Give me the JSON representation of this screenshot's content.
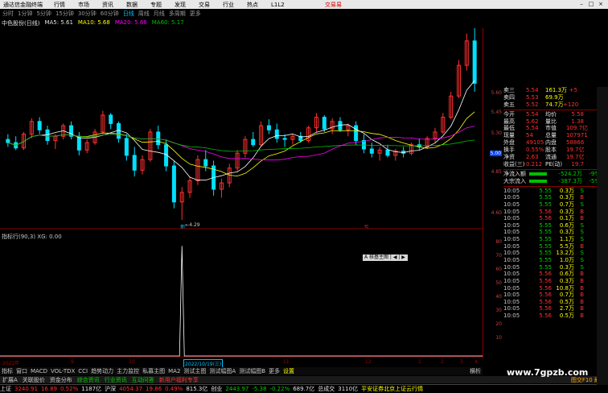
{
  "app": {
    "title": "通达信金融终端",
    "menus": [
      "行情",
      "市场",
      "资讯",
      "数据",
      "专题",
      "发现",
      "交易",
      "行业",
      "热点",
      "L1L2"
    ],
    "trade": "交易易"
  },
  "periods": [
    "分时",
    "1分钟",
    "5分钟",
    "15分钟",
    "30分钟",
    "60分钟",
    "日线",
    "周线",
    "月线",
    "多周期",
    "更多"
  ],
  "active_period": "日线",
  "legend": {
    "stock": "中色股份(日线)",
    "ma5": "MA5: 5.61",
    "ma10": "MA10: 5.68",
    "ma20": "MA20: 5.66",
    "ma60": "MA60: 5.17"
  },
  "colors": {
    "up": "#ff3030",
    "down": "#00e0ff",
    "ma5": "#ffffff",
    "ma10": "#ffff00",
    "ma20": "#ff00ff",
    "ma60": "#00c000"
  },
  "chart_data": {
    "type": "candlestick",
    "low_label": "4.29",
    "y_ticks": [
      "5.60",
      "5.45",
      "5.30",
      "5.15",
      "5.00",
      "4.85",
      "4.60"
    ],
    "ind_ticks": [
      "80",
      "70",
      "60",
      "50",
      "40",
      "30",
      "20",
      "10"
    ],
    "indicator_title": "指标行(90,3) XG: 0.00",
    "x_labels": [
      "2022年",
      "9",
      "10",
      "2022/10/19(三)",
      "11",
      "12",
      "1",
      "2",
      "3",
      "4"
    ],
    "markers": [
      "新",
      "亏"
    ],
    "candles": [
      [
        5.05,
        5.1,
        4.98,
        5.02
      ],
      [
        5.02,
        5.08,
        4.95,
        4.97
      ],
      [
        4.97,
        5.12,
        4.95,
        5.1
      ],
      [
        5.1,
        5.25,
        5.06,
        5.22
      ],
      [
        5.22,
        5.26,
        5.1,
        5.14
      ],
      [
        5.14,
        5.18,
        5.0,
        5.04
      ],
      [
        5.04,
        5.1,
        4.96,
        5.08
      ],
      [
        5.08,
        5.2,
        5.05,
        5.18
      ],
      [
        5.18,
        5.22,
        5.05,
        5.08
      ],
      [
        5.08,
        5.12,
        4.9,
        4.95
      ],
      [
        4.95,
        5.05,
        4.92,
        5.02
      ],
      [
        5.02,
        5.15,
        5.0,
        5.12
      ],
      [
        5.12,
        5.32,
        5.1,
        5.28
      ],
      [
        5.28,
        5.3,
        5.15,
        5.2
      ],
      [
        5.2,
        5.22,
        5.02,
        5.06
      ],
      [
        5.06,
        5.1,
        4.85,
        4.9
      ],
      [
        4.9,
        4.98,
        4.7,
        4.76
      ],
      [
        4.76,
        4.9,
        4.72,
        4.86
      ],
      [
        4.86,
        5.15,
        4.84,
        5.12
      ],
      [
        5.12,
        5.18,
        4.96,
        5.0
      ],
      [
        5.0,
        5.05,
        4.75,
        4.8
      ],
      [
        4.8,
        4.85,
        4.4,
        4.46
      ],
      [
        4.46,
        4.6,
        4.29,
        4.55
      ],
      [
        4.55,
        4.7,
        4.5,
        4.66
      ],
      [
        4.66,
        4.9,
        4.62,
        4.86
      ],
      [
        4.86,
        4.95,
        4.75,
        4.8
      ],
      [
        4.8,
        4.85,
        4.52,
        4.58
      ],
      [
        4.58,
        4.68,
        4.5,
        4.64
      ],
      [
        4.64,
        4.82,
        4.6,
        4.78
      ],
      [
        4.78,
        4.95,
        4.75,
        4.92
      ],
      [
        4.92,
        5.08,
        4.88,
        5.05
      ],
      [
        5.05,
        5.12,
        4.98,
        5.0
      ],
      [
        5.0,
        5.22,
        4.98,
        5.18
      ],
      [
        5.18,
        5.24,
        5.1,
        5.14
      ],
      [
        5.14,
        5.2,
        5.02,
        5.06
      ],
      [
        5.06,
        5.1,
        4.98,
        5.05
      ],
      [
        5.05,
        5.1,
        5.0,
        5.08
      ],
      [
        5.08,
        5.12,
        5.02,
        5.04
      ],
      [
        5.04,
        5.18,
        5.02,
        5.16
      ],
      [
        5.16,
        5.3,
        5.12,
        5.26
      ],
      [
        5.26,
        5.28,
        5.12,
        5.15
      ],
      [
        5.15,
        5.25,
        5.1,
        5.22
      ],
      [
        5.22,
        5.26,
        5.12,
        5.14
      ],
      [
        5.14,
        5.2,
        5.08,
        5.18
      ],
      [
        5.18,
        5.22,
        5.0,
        5.04
      ],
      [
        5.04,
        5.1,
        4.92,
        4.96
      ],
      [
        4.96,
        5.02,
        4.88,
        4.92
      ],
      [
        4.92,
        4.98,
        4.85,
        4.95
      ],
      [
        4.95,
        5.0,
        4.88,
        4.9
      ],
      [
        4.9,
        4.96,
        4.85,
        4.94
      ],
      [
        4.94,
        4.98,
        4.88,
        4.92
      ],
      [
        4.92,
        5.02,
        4.9,
        5.0
      ],
      [
        5.0,
        5.06,
        4.95,
        4.98
      ],
      [
        4.98,
        5.08,
        4.96,
        5.06
      ],
      [
        5.06,
        5.16,
        5.02,
        5.12
      ],
      [
        5.12,
        5.3,
        5.1,
        5.26
      ],
      [
        5.26,
        5.5,
        5.24,
        5.46
      ],
      [
        5.46,
        5.8,
        5.44,
        5.75
      ],
      [
        5.75,
        6.05,
        5.7,
        5.98
      ],
      [
        5.98,
        6.1,
        5.5,
        5.58
      ]
    ],
    "ind_spike": {
      "index": 22,
      "value": 80
    }
  },
  "quote": {
    "asks": [
      [
        "卖三",
        "5.54",
        "161.3万",
        "+5"
      ],
      [
        "卖四",
        "5.53",
        "69.9万",
        ""
      ],
      [
        "卖五",
        "5.52",
        "74.7万",
        "+120"
      ]
    ],
    "stats": [
      [
        "今开",
        "5.54",
        "均价",
        "5.58"
      ],
      [
        "最高",
        "5.62",
        "量比",
        "1.38"
      ],
      [
        "最低",
        "5.54",
        "市值",
        "109.7亿"
      ],
      [
        "现量",
        "54",
        "总量",
        "107971"
      ],
      [
        "外盘",
        "49105",
        "内盘",
        "58866"
      ],
      [
        "换手",
        "0.55%",
        "股本",
        "19.7亿"
      ],
      [
        "净资",
        "2.63",
        "流通",
        "19.7亿"
      ],
      [
        "收益(三)",
        "0.212",
        "PE(动)",
        "19.7"
      ]
    ],
    "flows": [
      [
        "净流入额",
        "-524.2万",
        "-9%"
      ],
      [
        "大宗流入",
        "-387.3万",
        "-5%"
      ]
    ],
    "ticks": [
      [
        "10:05",
        "5.55",
        "0.3万",
        "S"
      ],
      [
        "10:05",
        "5.55",
        "0.3万",
        "B"
      ],
      [
        "10:05",
        "5.55",
        "0.7万",
        "S"
      ],
      [
        "10:05",
        "5.56",
        "0.3万",
        "B"
      ],
      [
        "10:05",
        "5.56",
        "0.1万",
        "B"
      ],
      [
        "10:05",
        "5.55",
        "0.6万",
        "S"
      ],
      [
        "10:05",
        "5.55",
        "0.3万",
        "S"
      ],
      [
        "10:05",
        "5.55",
        "1.1万",
        "S"
      ],
      [
        "10:05",
        "5.55",
        "5.5万",
        "B"
      ],
      [
        "10:05",
        "5.55",
        "13.2万",
        "S"
      ],
      [
        "10:05",
        "5.55",
        "1.0万",
        "S"
      ],
      [
        "10:05",
        "5.55",
        "0.3万",
        "S"
      ],
      [
        "10:05",
        "5.56",
        "0.6万",
        "B"
      ],
      [
        "10:05",
        "5.56",
        "0.3万",
        "B"
      ],
      [
        "10:05",
        "5.56",
        "10.8万",
        "B"
      ],
      [
        "10:05",
        "5.56",
        "0.7万",
        "B"
      ],
      [
        "10:05",
        "5.56",
        "0.5万",
        "B"
      ],
      [
        "10:05",
        "5.56",
        "2.7万",
        "B"
      ],
      [
        "10:05",
        "5.56",
        "0.5万",
        "B"
      ]
    ]
  },
  "tabs": [
    "指标",
    "窗口",
    "MACD",
    "VOL-TDX",
    "CCI",
    "趋势动力",
    "主力监控",
    "私募主图",
    "MA2",
    "测试主图",
    "测试幅图A",
    "测试幅图B",
    "更多",
    "设置"
  ],
  "active_tab": "测试幅图B",
  "tabs_right": "横析",
  "bottom_tabs": [
    "扩展A",
    "关联股价",
    "资金分布",
    "综合资讯",
    "行业资讯",
    "互动问答",
    "新用户福利专享"
  ],
  "status": {
    "sh_label": "上证",
    "sh_val": "3240.91",
    "sh_chg": "16.89",
    "sh_pct": "0.52%",
    "sh_amt": "1187亿",
    "sz_label": "沪深",
    "sz_val": "4054.37",
    "sz_chg": "19.86",
    "sz_pct": "0.49%",
    "sz_amt": "815.3亿",
    "cy_label": "创业",
    "cy_val": "2443.97",
    "cy_chg": "-5.38",
    "cy_pct": "-0.22%",
    "cy_amt": "689.7亿",
    "total_label": "总成交",
    "total_val": "3110亿",
    "broker": "平安证券北京上证云行情",
    "right": "图交F10 刷新"
  },
  "popup": "A 核基主图 | ◀ | ▶",
  "price_tag": "5.00",
  "watermark": "www.7gpzb.com"
}
